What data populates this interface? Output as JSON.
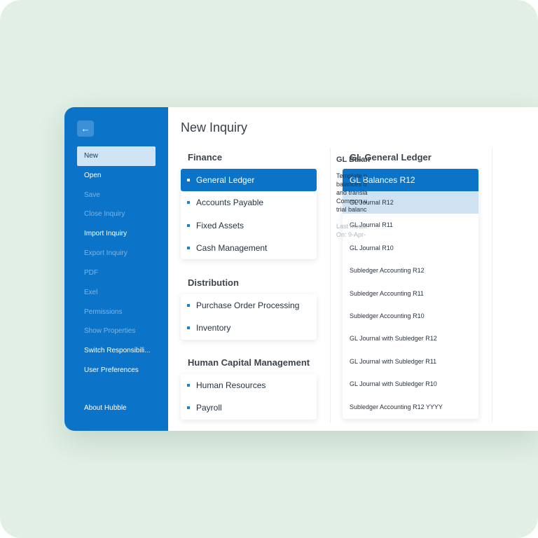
{
  "sidebar": {
    "items": [
      {
        "label": "New",
        "state": "active"
      },
      {
        "label": "Open",
        "state": "enabled"
      },
      {
        "label": "Save",
        "state": "disabled"
      },
      {
        "label": "Close Inquiry",
        "state": "disabled"
      },
      {
        "label": "Import Inquiry",
        "state": "enabled"
      },
      {
        "label": "Export Inquiry",
        "state": "disabled"
      },
      {
        "label": "PDF",
        "state": "disabled"
      },
      {
        "label": "Exel",
        "state": "disabled"
      },
      {
        "label": "Permissions",
        "state": "disabled"
      },
      {
        "label": "Show Properties",
        "state": "disabled"
      },
      {
        "label": "Switch Responsibili...",
        "state": "enabled"
      },
      {
        "label": "User Preferences",
        "state": "enabled"
      }
    ],
    "about": "About Hubble",
    "back_icon": "arrow-left-icon"
  },
  "main": {
    "title": "New Inquiry",
    "sections": [
      {
        "title": "Finance",
        "items": [
          "General Ledger",
          "Accounts Payable",
          "Fixed Assets",
          "Cash Management"
        ],
        "selected_index": 0
      },
      {
        "title": "Distribution",
        "items": [
          "Purchase Order Processing",
          "Inventory"
        ]
      },
      {
        "title": "Human Capital Management",
        "items": [
          "Human Resources",
          "Payroll"
        ]
      }
    ]
  },
  "gl": {
    "title": "GL General Ledger",
    "selected": "GL Balances R12",
    "items": [
      "GL Journal R12",
      "GL Journal R11",
      "GL Journal R10",
      "Subledger Accounting R12",
      "Subledger Accounting R11",
      "Subledger Accounting R10",
      "GL Journal with Subledger R12",
      "GL Journal with Subledger R11",
      "GL Journal with Subledger R10",
      "Subledger Accounting R12 YYYY"
    ],
    "highlight_index": 0
  },
  "detail": {
    "title": "GL Balan",
    "description_lines": [
      "Template p",
      "balances b",
      "and transla",
      "Common u",
      "trial balanc"
    ],
    "meta_lines": [
      "Last modifi",
      "On: 9-Apr-"
    ]
  },
  "colors": {
    "sidebar_bg": "#0b74c9",
    "selected_bg": "#0b74c9",
    "highlight_bg": "#cfe2f2",
    "page_bg": "#e1efe4"
  }
}
